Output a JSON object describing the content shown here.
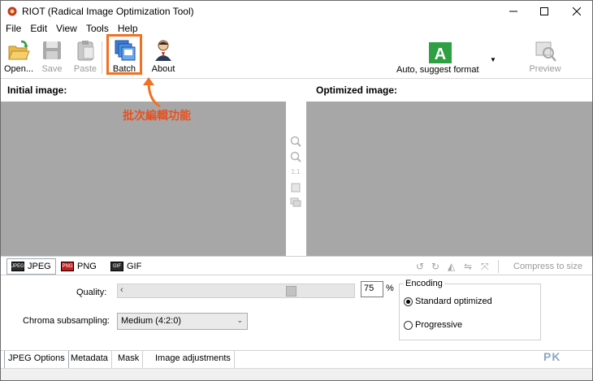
{
  "window": {
    "title": "RIOT (Radical Image Optimization Tool)"
  },
  "menu": [
    "File",
    "Edit",
    "View",
    "Tools",
    "Help"
  ],
  "toolbar": {
    "open": "Open...",
    "save": "Save",
    "paste": "Paste",
    "batch": "Batch",
    "about": "About",
    "format": "Auto, suggest format",
    "preview": "Preview"
  },
  "panes": {
    "initial": "Initial image:",
    "optimized": "Optimized image:"
  },
  "annotation": "批次編輯功能",
  "mid_tools": {
    "one_to_one": "1:1"
  },
  "format_tabs": [
    "JPEG",
    "PNG",
    "GIF"
  ],
  "format_icons": [
    "JPEG",
    "PNG",
    "GIF"
  ],
  "compress_to_size": "Compress to size",
  "jpeg_options": {
    "quality_label": "Quality:",
    "quality_value": "75",
    "quality_unit": "%",
    "quality_fraction": 0.75,
    "chroma_label": "Chroma subsampling:",
    "chroma_value": "Medium (4:2:0)",
    "encoding_title": "Encoding",
    "encoding_options": [
      "Standard optimized",
      "Progressive"
    ],
    "encoding_selected": "Standard optimized"
  },
  "bottom_tabs": [
    "JPEG Options",
    "Metadata",
    "Mask",
    "Image adjustments"
  ],
  "watermark": "PK",
  "colors": {
    "highlight": "#f37021",
    "pane_gray": "#a7a7a7",
    "annotation": "#e8501e"
  }
}
